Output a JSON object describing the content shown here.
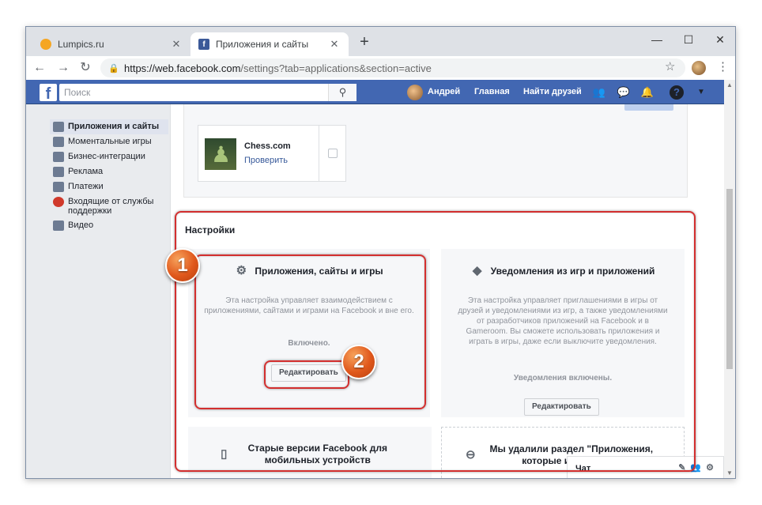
{
  "browser": {
    "tabs": [
      {
        "title": "Lumpics.ru",
        "favicon_color": "#f5a623"
      },
      {
        "title": "Приложения и сайты",
        "favicon_color": "#3b5998"
      }
    ],
    "new_tab": "+",
    "url_host": "https://web.facebook.com",
    "url_path": "/settings?tab=applications&section=active",
    "controls": {
      "minimize": "—",
      "maximize": "☐",
      "close": "✕"
    }
  },
  "fb": {
    "logo": "f",
    "search_placeholder": "Поиск",
    "user_name": "Андрей",
    "nav_home": "Главная",
    "nav_find_friends": "Найти друзей",
    "brand_color": "#4267b2"
  },
  "sidebar": {
    "items": [
      {
        "label": "Приложения и сайты",
        "active": true
      },
      {
        "label": "Моментальные игры"
      },
      {
        "label": "Бизнес-интеграции"
      },
      {
        "label": "Реклама"
      },
      {
        "label": "Платежи"
      },
      {
        "label": "Входящие от службы поддержки"
      },
      {
        "label": "Видео"
      }
    ]
  },
  "apps": {
    "card": {
      "name": "Chess.com",
      "action": "Проверить"
    }
  },
  "settings": {
    "title": "Настройки",
    "tiles": [
      {
        "title": "Приложения, сайты и игры",
        "desc": "Эта настройка управляет взаимодействием с приложениями, сайтами и играми на Facebook и вне его.",
        "status": "Включено.",
        "button": "Редактировать"
      },
      {
        "title": "Уведомления из игр и приложений",
        "desc": "Эта настройка управляет приглашениями в игры от друзей и уведомлениями из игр, а также уведомлениями от разработчиков приложений на Facebook и в Gameroom. Вы сможете использовать приложения и играть в игры, даже если выключите уведомления.",
        "status": "Уведомления включены.",
        "button": "Редактировать"
      },
      {
        "title": "Старые версии Facebook для мобильных устройств"
      },
      {
        "title": "Мы удалили раздел \"Приложения, которые используют"
      }
    ]
  },
  "chat": {
    "label": "Чат"
  },
  "annotations": {
    "badge1": "1",
    "badge2": "2",
    "highlight_color": "#d32f2f"
  }
}
